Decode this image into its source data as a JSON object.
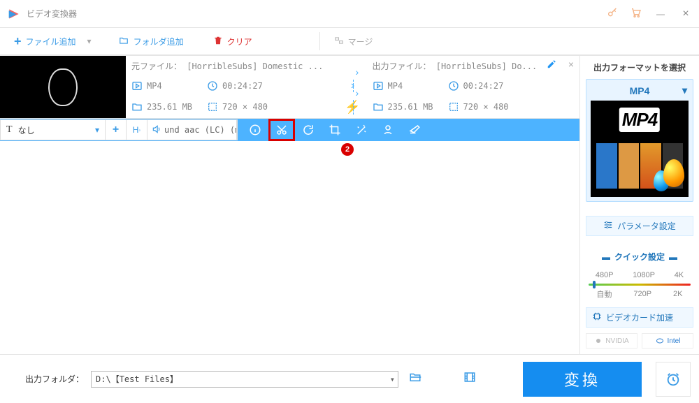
{
  "app": {
    "title": "ビデオ変換器"
  },
  "toolbar": {
    "add_file": "ファイル追加",
    "add_folder": "フォルダ追加",
    "clear": "クリア",
    "merge": "マージ"
  },
  "file": {
    "source_label": "元ファイル： [HorribleSubs] Domestic ...",
    "output_label": "出力ファイル： [HorribleSubs] Do...",
    "src_format": "MP4",
    "src_duration": "00:24:27",
    "src_size": "235.61 MB",
    "src_dims": "720 × 480",
    "out_format": "MP4",
    "out_duration": "00:24:27",
    "out_size": "235.61 MB",
    "out_dims": "720 × 480",
    "subtitle_select": "なし",
    "audio_select": "und aac (LC) (mp"
  },
  "sidebar": {
    "title": "出力フォーマットを選択",
    "format": "MP4",
    "param_settings": "パラメータ設定",
    "quick_settings": "クイック設定",
    "presets_top": [
      "480P",
      "1080P",
      "4K"
    ],
    "presets_bot": [
      "自動",
      "720P",
      "2K"
    ],
    "gpu_accel": "ビデオカード加速",
    "vendors": [
      "NVIDIA",
      "Intel"
    ]
  },
  "footer": {
    "out_folder_label": "出力フォルダ：",
    "out_folder_path": "D:\\【Test Files】",
    "convert": "変換"
  },
  "badge": "2"
}
